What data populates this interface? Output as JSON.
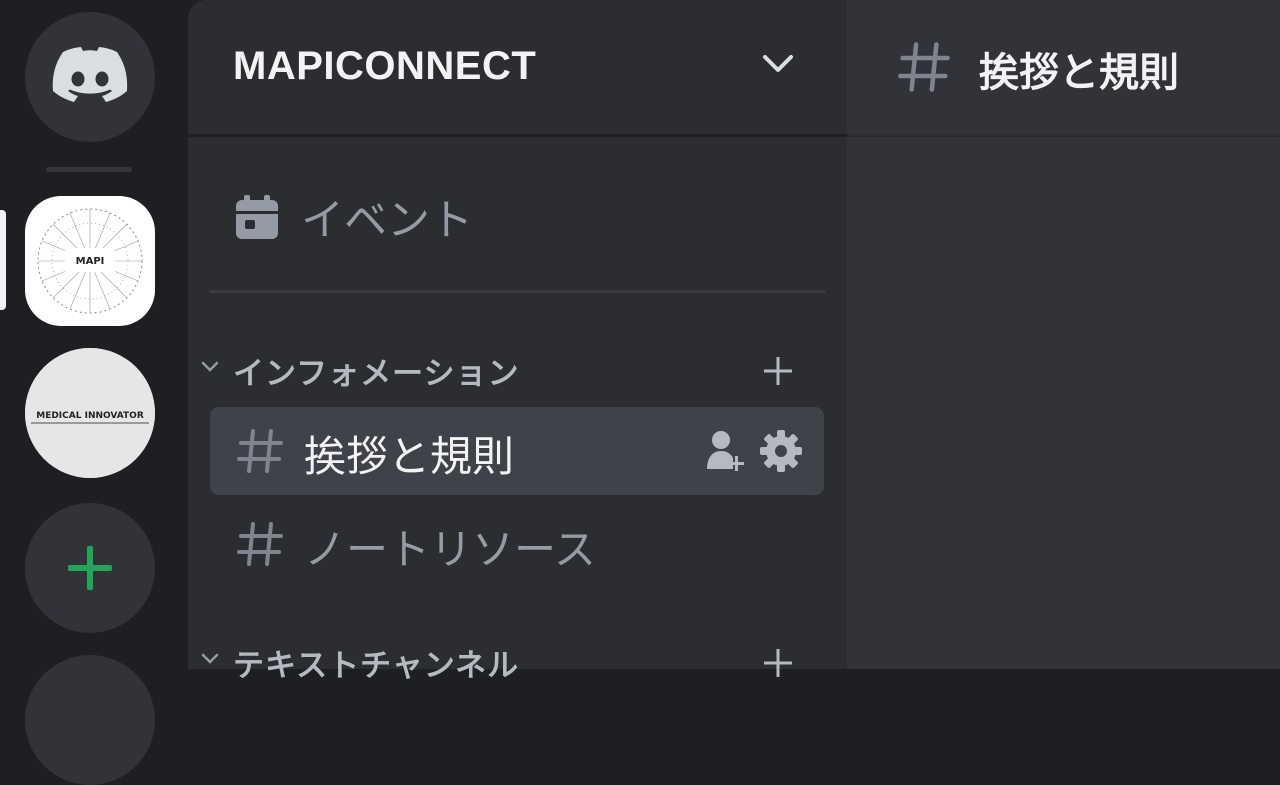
{
  "server": {
    "name": "MAPICONNECT"
  },
  "rail": {
    "servers": [
      {
        "name": "MAPI",
        "logo_text": "MAPI"
      },
      {
        "name": "MEDICAL INNOVATOR",
        "logo_text": "MEDICAL INNOVATOR"
      }
    ]
  },
  "sidebar": {
    "events_label": "イベント",
    "categories": [
      {
        "name": "インフォメーション",
        "channels": [
          {
            "name": "挨拶と規則",
            "active": true
          },
          {
            "name": "ノートリソース",
            "active": false
          }
        ]
      },
      {
        "name": "テキストチャンネル",
        "channels": []
      }
    ]
  },
  "main": {
    "channel_title": "挨拶と規則"
  },
  "colors": {
    "rail_bg": "#1e1f22",
    "sidebar_bg": "#2b2d31",
    "main_bg": "#313338",
    "active_channel_bg": "#404249",
    "muted_text": "#949ba4",
    "add_green": "#23a55a"
  }
}
